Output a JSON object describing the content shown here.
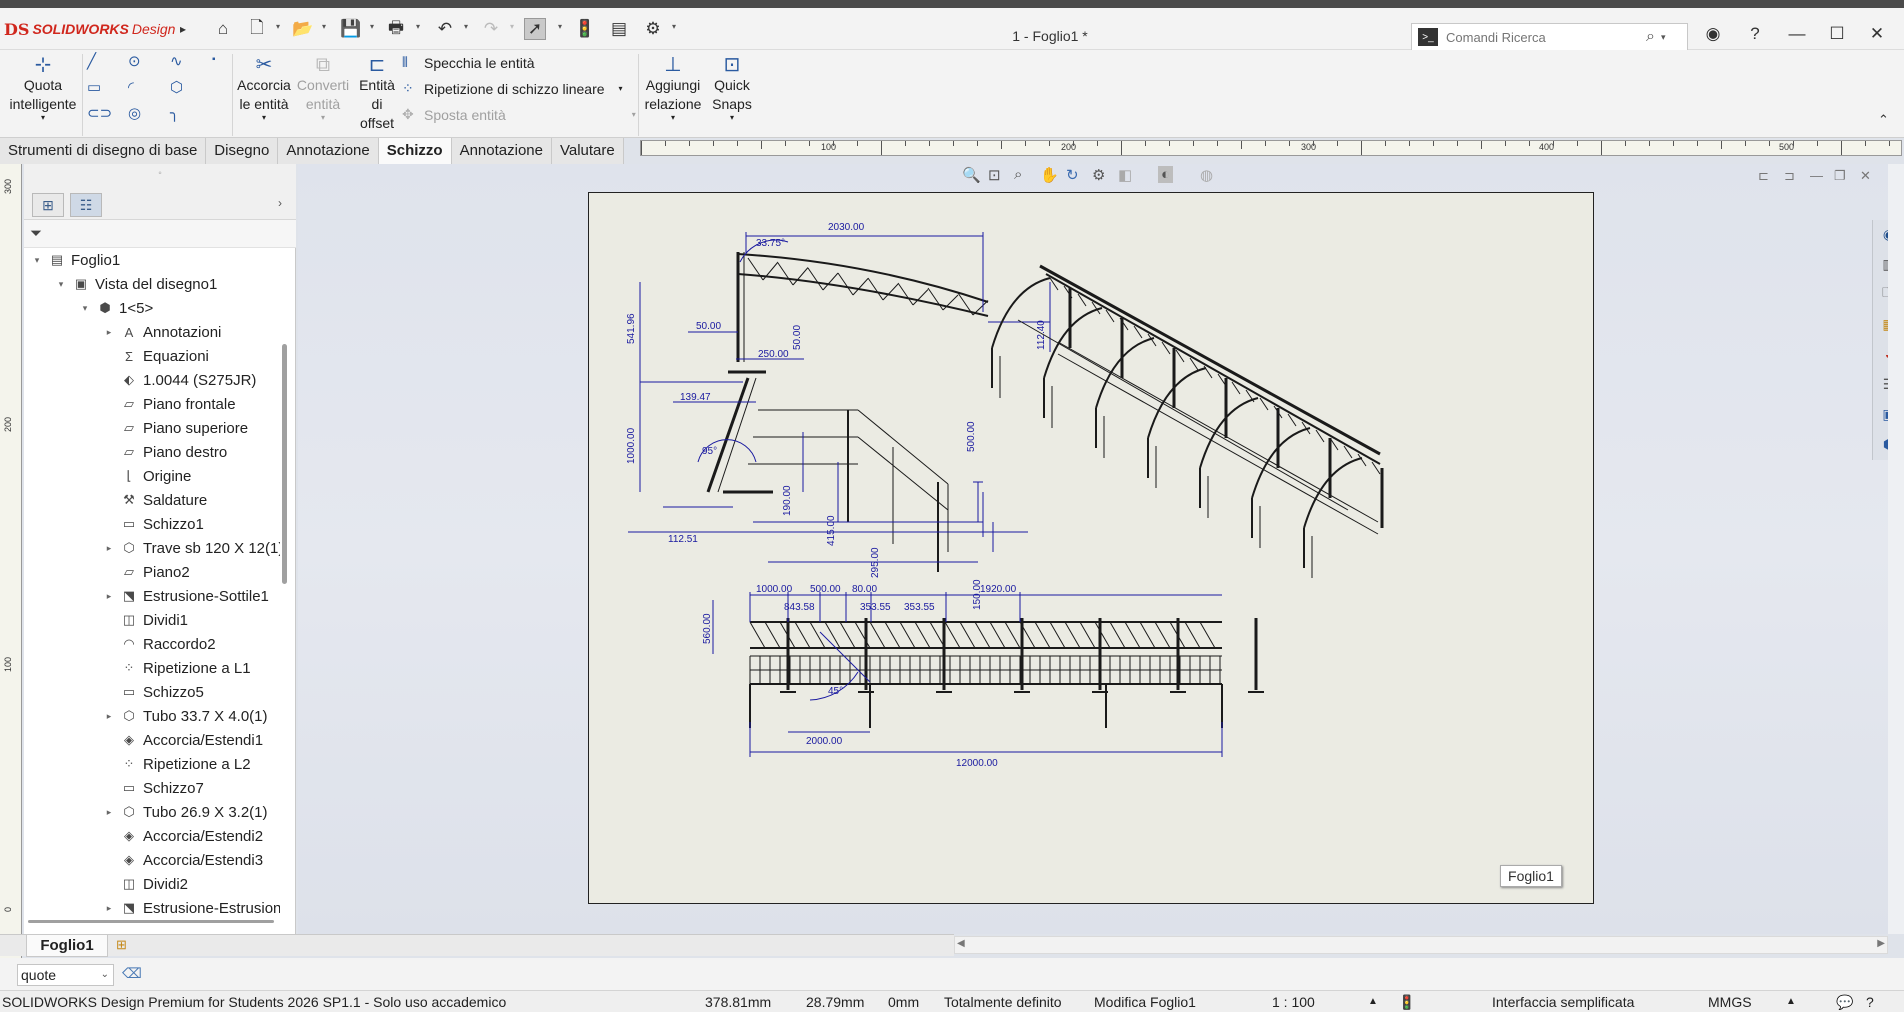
{
  "app": {
    "logo_prefix": "DS",
    "logo_brand": "SOLIDWORKS",
    "logo_suffix": "Design",
    "document_title": "1 - Foglio1 *"
  },
  "search": {
    "placeholder": "Comandi Ricerca"
  },
  "ribbon": {
    "smart_dimension": "Quota intelligente",
    "trim_entities": "Accorcia le entità",
    "convert_entities": "Converti entità",
    "offset_entities": "Entità di offset",
    "mirror_entities": "Specchia le entità",
    "linear_pattern": "Ripetizione di schizzo lineare",
    "move_entities": "Sposta entità",
    "add_relation": "Aggiungi relazione",
    "quick_snaps": "Quick Snaps"
  },
  "tabs": [
    "Strumenti di disegno di base",
    "Disegno",
    "Annotazione",
    "Schizzo",
    "Annotazione",
    "Valutare"
  ],
  "active_tab_index": 3,
  "ruler_top_labels": [
    "100",
    "200",
    "300",
    "400",
    "500"
  ],
  "ruler_left_labels": [
    "300",
    "200",
    "100",
    "0"
  ],
  "tree": [
    {
      "label": "Foglio1",
      "icon": "sheet-icon",
      "level": 0,
      "expander": "▾"
    },
    {
      "label": "Vista del disegno1",
      "icon": "drawing-view-icon",
      "level": 1,
      "expander": "▾"
    },
    {
      "label": "1<5>",
      "icon": "part-icon",
      "level": 2,
      "expander": "▾"
    },
    {
      "label": "Annotazioni",
      "icon": "annotation-icon",
      "level": 3,
      "expander": "▸"
    },
    {
      "label": "Equazioni",
      "icon": "equation-icon",
      "level": 3,
      "expander": ""
    },
    {
      "label": "1.0044 (S275JR)",
      "icon": "material-icon",
      "level": 3,
      "expander": ""
    },
    {
      "label": "Piano frontale",
      "icon": "plane-icon",
      "level": 3,
      "expander": ""
    },
    {
      "label": "Piano superiore",
      "icon": "plane-icon",
      "level": 3,
      "expander": ""
    },
    {
      "label": "Piano destro",
      "icon": "plane-icon",
      "level": 3,
      "expander": ""
    },
    {
      "label": "Origine",
      "icon": "origin-icon",
      "level": 3,
      "expander": ""
    },
    {
      "label": "Saldature",
      "icon": "weldment-icon",
      "level": 3,
      "expander": ""
    },
    {
      "label": "Schizzo1",
      "icon": "sketch-icon",
      "level": 3,
      "expander": ""
    },
    {
      "label": "Trave sb 120 X 12(1)",
      "icon": "structural-member-icon",
      "level": 3,
      "expander": "▸"
    },
    {
      "label": "Piano2",
      "icon": "plane-icon",
      "level": 3,
      "expander": ""
    },
    {
      "label": "Estrusione-Sottile1",
      "icon": "extrude-icon",
      "level": 3,
      "expander": "▸"
    },
    {
      "label": "Dividi1",
      "icon": "split-icon",
      "level": 3,
      "expander": ""
    },
    {
      "label": "Raccordo2",
      "icon": "fillet-icon",
      "level": 3,
      "expander": ""
    },
    {
      "label": "Ripetizione a L1",
      "icon": "pattern-icon",
      "level": 3,
      "expander": ""
    },
    {
      "label": "Schizzo5",
      "icon": "sketch-icon",
      "level": 3,
      "expander": ""
    },
    {
      "label": "Tubo 33.7 X 4.0(1)",
      "icon": "structural-member-icon",
      "level": 3,
      "expander": "▸"
    },
    {
      "label": "Accorcia/Estendi1",
      "icon": "trim-extend-icon",
      "level": 3,
      "expander": ""
    },
    {
      "label": "Ripetizione a L2",
      "icon": "pattern-icon",
      "level": 3,
      "expander": ""
    },
    {
      "label": "Schizzo7",
      "icon": "sketch-icon",
      "level": 3,
      "expander": ""
    },
    {
      "label": "Tubo 26.9 X 3.2(1)",
      "icon": "structural-member-icon",
      "level": 3,
      "expander": "▸"
    },
    {
      "label": "Accorcia/Estendi2",
      "icon": "trim-extend-icon",
      "level": 3,
      "expander": ""
    },
    {
      "label": "Accorcia/Estendi3",
      "icon": "trim-extend-icon",
      "level": 3,
      "expander": ""
    },
    {
      "label": "Dividi2",
      "icon": "split-icon",
      "level": 3,
      "expander": ""
    },
    {
      "label": "Estrusione-Estrusion",
      "icon": "extrude-icon",
      "level": 3,
      "expander": "▸"
    }
  ],
  "drawing": {
    "sheet_label": "Foglio1",
    "dims_side": [
      "2030.00",
      "33.75°",
      "541.96",
      "112.40",
      "50.00",
      "50.00",
      "250.00",
      "139.47",
      "1000.00",
      "500.00",
      "95°",
      "190.00",
      "415.00",
      "112.51",
      "295.00",
      "150.00",
      "843.58",
      "353.55",
      "353.55"
    ],
    "dims_front": [
      "1000.00",
      "500.00",
      "80.00",
      "1920.00",
      "560.00",
      "45°",
      "2000.00",
      "12000.00"
    ]
  },
  "bottom": {
    "sheet_tab": "Foglio1",
    "filter_value": "quote"
  },
  "status": {
    "product": "SOLIDWORKS Design Premium for Students 2026 SP1.1 - Solo uso accademico",
    "x": "378.81mm",
    "y": "28.79mm",
    "z": "0mm",
    "state": "Totalmente definito",
    "mode": "Modifica Foglio1",
    "scale": "1 : 100",
    "interface": "Interfaccia semplificata",
    "units": "MMGS"
  }
}
